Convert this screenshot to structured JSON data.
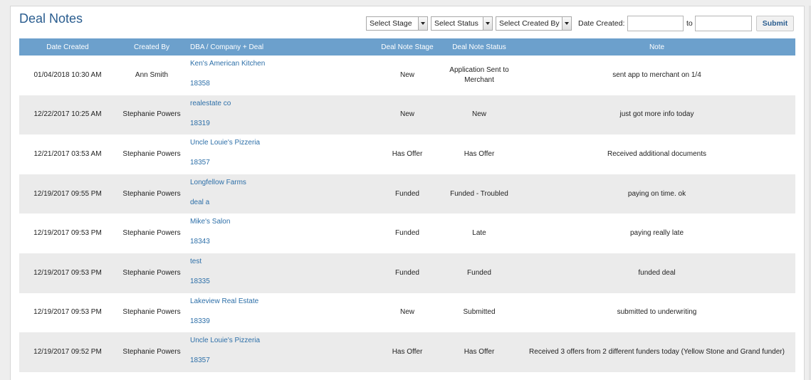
{
  "page": {
    "title": "Deal Notes"
  },
  "filters": {
    "stage": "Select Stage",
    "status": "Select Status",
    "created_by": "Select Created By",
    "date_label": "Date Created:",
    "to_label": "to",
    "submit": "Submit"
  },
  "table": {
    "headers": {
      "date": "Date Created",
      "created_by": "Created By",
      "deal": "DBA / Company + Deal",
      "stage": "Deal Note Stage",
      "status": "Deal Note Status",
      "note": "Note"
    },
    "rows": [
      {
        "date": "01/04/2018 10:30 AM",
        "created_by": "Ann Smith",
        "company": "Ken's American Kitchen",
        "deal": "18358",
        "stage": "New",
        "status": "Application Sent to Merchant",
        "note": "sent app to merchant on 1/4"
      },
      {
        "date": "12/22/2017 10:25 AM",
        "created_by": "Stephanie Powers",
        "company": "realestate co",
        "deal": "18319",
        "stage": "New",
        "status": "New",
        "note": "just got more info today"
      },
      {
        "date": "12/21/2017 03:53 AM",
        "created_by": "Stephanie Powers",
        "company": "Uncle Louie's Pizzeria",
        "deal": "18357",
        "stage": "Has Offer",
        "status": "Has Offer",
        "note": "Received additional documents"
      },
      {
        "date": "12/19/2017 09:55 PM",
        "created_by": "Stephanie Powers",
        "company": "Longfellow Farms",
        "deal": "deal a",
        "stage": "Funded",
        "status": "Funded - Troubled",
        "note": "paying on time. ok"
      },
      {
        "date": "12/19/2017 09:53 PM",
        "created_by": "Stephanie Powers",
        "company": "Mike's Salon",
        "deal": "18343",
        "stage": "Funded",
        "status": "Late",
        "note": "paying really late"
      },
      {
        "date": "12/19/2017 09:53 PM",
        "created_by": "Stephanie Powers",
        "company": "test",
        "deal": "18335",
        "stage": "Funded",
        "status": "Funded",
        "note": "funded deal"
      },
      {
        "date": "12/19/2017 09:53 PM",
        "created_by": "Stephanie Powers",
        "company": "Lakeview Real Estate",
        "deal": "18339",
        "stage": "New",
        "status": "Submitted",
        "note": "submitted to underwriting"
      },
      {
        "date": "12/19/2017 09:52 PM",
        "created_by": "Stephanie Powers",
        "company": "Uncle Louie's Pizzeria",
        "deal": "18357",
        "stage": "Has Offer",
        "status": "Has Offer",
        "note": "Received 3 offers from 2 different funders today (Yellow Stone and Grand funder)"
      }
    ]
  },
  "colors": {
    "header_bg": "#6ca0cc",
    "link": "#2d6fa8",
    "title": "#2a5d8f",
    "row_alt": "#ebebeb"
  }
}
